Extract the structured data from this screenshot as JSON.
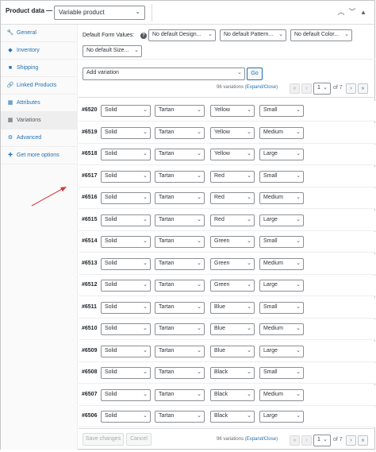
{
  "header": {
    "title": "Product data —",
    "product_type": "Variable product"
  },
  "sidebar": {
    "items": [
      {
        "label": "General",
        "icon": "wrench-icon",
        "glyph": "🔧",
        "active": false
      },
      {
        "label": "Inventory",
        "icon": "tag-icon",
        "glyph": "◆",
        "active": false
      },
      {
        "label": "Shipping",
        "icon": "truck-icon",
        "glyph": "■",
        "active": false
      },
      {
        "label": "Linked Products",
        "icon": "link-icon",
        "glyph": "🔗",
        "active": false
      },
      {
        "label": "Attributes",
        "icon": "table-icon",
        "glyph": "▦",
        "active": false
      },
      {
        "label": "Variations",
        "icon": "grid-icon",
        "glyph": "▦",
        "active": true
      },
      {
        "label": "Advanced",
        "icon": "gear-icon",
        "glyph": "⚙",
        "active": false
      },
      {
        "label": "Get more options",
        "icon": "plugin-icon",
        "glyph": "✚",
        "active": false
      }
    ]
  },
  "defaults": {
    "label": "Default Form Values:",
    "selects": [
      "No default Design...",
      "No default Pattern...",
      "No default Color...",
      "No default Size..."
    ]
  },
  "add_variation": {
    "select_value": "Add variation",
    "go_label": "Go"
  },
  "pagination": {
    "count_text": "96 variations",
    "expand": "Expand",
    "sep": "/",
    "close": "Close",
    "open_paren": "(",
    "close_paren": ")",
    "page": "1",
    "of_text": "of 7"
  },
  "variations": [
    {
      "id": "#6520",
      "design": "Solid",
      "pattern": "Tartan",
      "color": "Yellow",
      "size": "Small"
    },
    {
      "id": "#6519",
      "design": "Solid",
      "pattern": "Tartan",
      "color": "Yellow",
      "size": "Medium"
    },
    {
      "id": "#6518",
      "design": "Solid",
      "pattern": "Tartan",
      "color": "Yellow",
      "size": "Large"
    },
    {
      "id": "#6517",
      "design": "Solid",
      "pattern": "Tartan",
      "color": "Red",
      "size": "Small"
    },
    {
      "id": "#6516",
      "design": "Solid",
      "pattern": "Tartan",
      "color": "Red",
      "size": "Medium"
    },
    {
      "id": "#6515",
      "design": "Solid",
      "pattern": "Tartan",
      "color": "Red",
      "size": "Large"
    },
    {
      "id": "#6514",
      "design": "Solid",
      "pattern": "Tartan",
      "color": "Green",
      "size": "Small"
    },
    {
      "id": "#6513",
      "design": "Solid",
      "pattern": "Tartan",
      "color": "Green",
      "size": "Medium"
    },
    {
      "id": "#6512",
      "design": "Solid",
      "pattern": "Tartan",
      "color": "Green",
      "size": "Large"
    },
    {
      "id": "#6511",
      "design": "Solid",
      "pattern": "Tartan",
      "color": "Blue",
      "size": "Small"
    },
    {
      "id": "#6510",
      "design": "Solid",
      "pattern": "Tartan",
      "color": "Blue",
      "size": "Medium"
    },
    {
      "id": "#6509",
      "design": "Solid",
      "pattern": "Tartan",
      "color": "Blue",
      "size": "Large"
    },
    {
      "id": "#6508",
      "design": "Solid",
      "pattern": "Tartan",
      "color": "Black",
      "size": "Small"
    },
    {
      "id": "#6507",
      "design": "Solid",
      "pattern": "Tartan",
      "color": "Black",
      "size": "Medium"
    },
    {
      "id": "#6506",
      "design": "Solid",
      "pattern": "Tartan",
      "color": "Black",
      "size": "Large"
    }
  ],
  "footer": {
    "save_label": "Save changes",
    "cancel_label": "Cancel"
  },
  "colors": {
    "link": "#2271b1",
    "border": "#8c8f94",
    "annotation_arrow": "#d63638"
  }
}
